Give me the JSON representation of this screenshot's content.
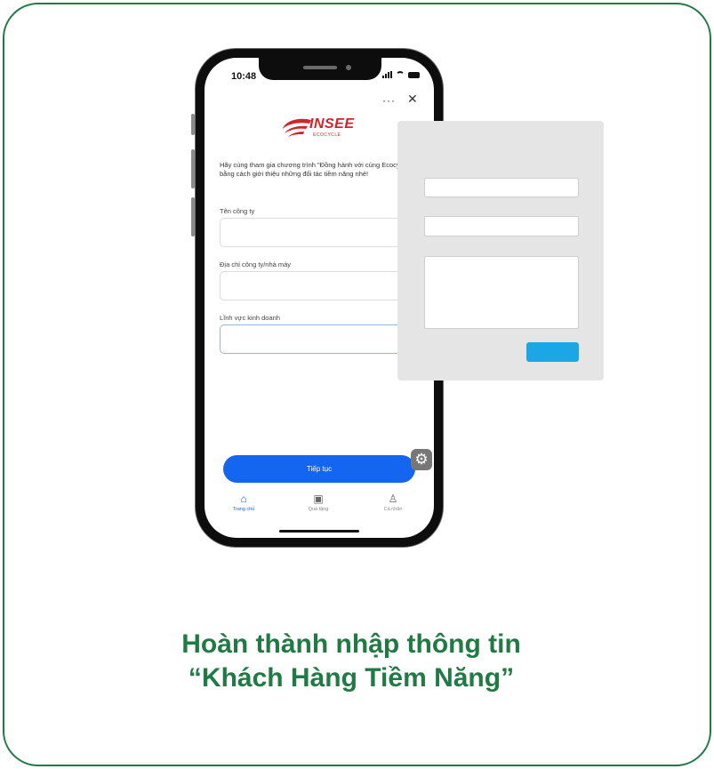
{
  "phone": {
    "status_time": "10:48",
    "menu_dots": "···",
    "close_symbol": "✕",
    "logo": {
      "text": "INSEE",
      "sub": "ECOCYCLE"
    },
    "intro": "Hãy cùng tham gia chương trình \"Đồng hành với cùng Ecocycle\" bằng cách giới thiệu những đối tác tiềm năng nhé!",
    "fields": [
      {
        "label": "Tên công ty"
      },
      {
        "label": "Địa chỉ công ty/nhà máy"
      },
      {
        "label": "Lĩnh vực kinh doanh"
      }
    ],
    "continue_label": "Tiếp tục",
    "tabs": [
      {
        "icon": "home-icon",
        "label": "Trang chủ",
        "active": true
      },
      {
        "icon": "gift-icon",
        "label": "Quà tặng",
        "active": false
      },
      {
        "icon": "user-icon",
        "label": "Cá nhân",
        "active": false
      }
    ]
  },
  "overlay_form": {
    "accent": "#1ba6e6"
  },
  "caption": {
    "line1": "Hoàn thành nhập thông tin",
    "line2": "“Khách Hàng Tiềm Năng”"
  },
  "colors": {
    "brand_green": "#1f7a44",
    "primary_blue": "#1466f0",
    "insee_red": "#d3232a"
  }
}
